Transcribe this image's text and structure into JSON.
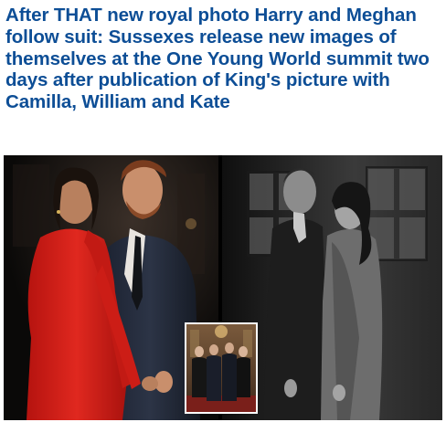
{
  "article": {
    "headline": "After THAT new royal photo Harry and Meghan follow suit: Sussexes release new images of themselves at the One Young World summit two days after publication of King's picture with Camilla, William and Kate"
  },
  "colors": {
    "headline": "#0d4e96",
    "red_outfit": "#d91f1a"
  }
}
